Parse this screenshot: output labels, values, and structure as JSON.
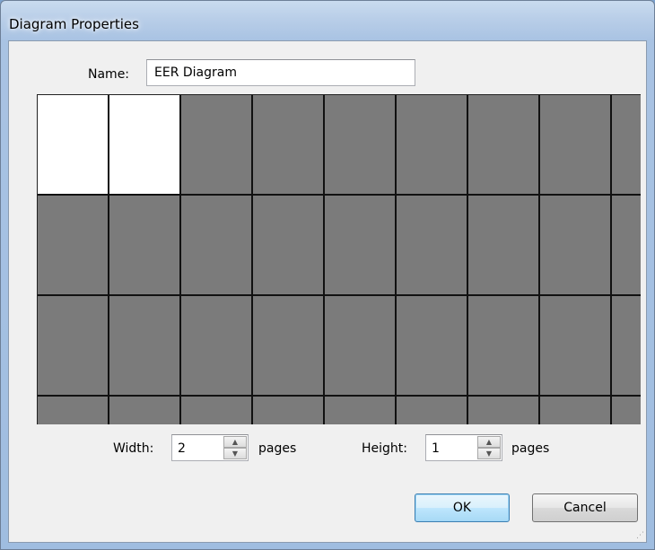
{
  "window": {
    "title": "Diagram Properties"
  },
  "form": {
    "name_label": "Name:",
    "name_value": "EER Diagram"
  },
  "page_grid": {
    "columns": 9,
    "rows": 4,
    "selected_columns": 2,
    "selected_rows": 1,
    "selected_color": "#ffffff",
    "unselected_color": "#7b7b7b",
    "line_color": "#111111"
  },
  "size": {
    "width_label": "Width:",
    "width_value": "2",
    "width_unit": "pages",
    "height_label": "Height:",
    "height_value": "1",
    "height_unit": "pages"
  },
  "buttons": {
    "ok": "OK",
    "cancel": "Cancel"
  },
  "icons": {
    "spin_up": "spin-up-arrow-icon",
    "spin_down": "spin-down-arrow-icon",
    "resize": "resize-grip-icon"
  }
}
